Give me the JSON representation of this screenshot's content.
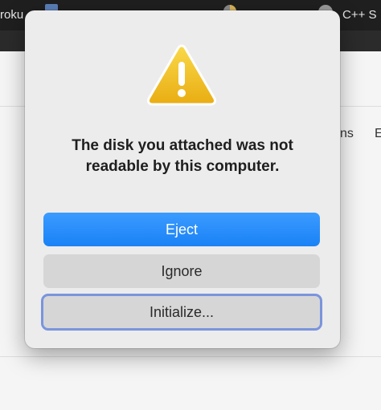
{
  "background": {
    "tab_left_label": "roku",
    "tab_right_label": "C++ S",
    "side_text_1": "ns",
    "side_text_2": "E"
  },
  "alert": {
    "icon": "warning-icon",
    "message_line1": "The disk you attached was not",
    "message_line2": "readable by this computer.",
    "buttons": {
      "eject": "Eject",
      "ignore": "Ignore",
      "initialize": "Initialize..."
    }
  },
  "colors": {
    "accent": "#1a82f6",
    "warning": "#f2c21b",
    "focus_ring": "#7a94dd"
  }
}
